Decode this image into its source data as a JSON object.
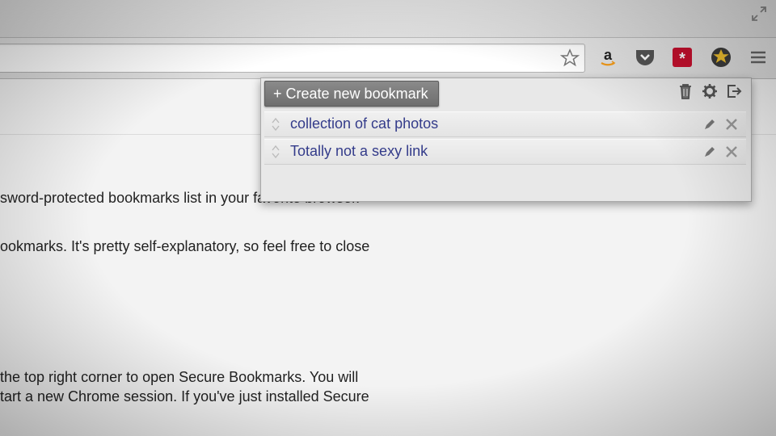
{
  "toolbar": {
    "icons": [
      "bookmark-star-icon",
      "amazon-icon",
      "pocket-icon",
      "lastpass-icon",
      "secure-bookmarks-extension-icon",
      "menu-icon"
    ]
  },
  "popup": {
    "create_label": "+ Create new bookmark",
    "actions": [
      "trash-icon",
      "gear-icon",
      "logout-icon"
    ],
    "bookmarks": [
      {
        "title": "collection of cat photos"
      },
      {
        "title": "Totally not a sexy link"
      }
    ]
  },
  "page": {
    "lines": [
      "sword-protected bookmarks list in your favorite browser.",
      "ookmarks. It's pretty self-explanatory, so feel free to close",
      "the top right corner to open Secure Bookmarks. You will",
      "tart a new Chrome session. If you've just installed Secure"
    ]
  },
  "colors": {
    "link": "#333b8a",
    "button": "#777777"
  }
}
